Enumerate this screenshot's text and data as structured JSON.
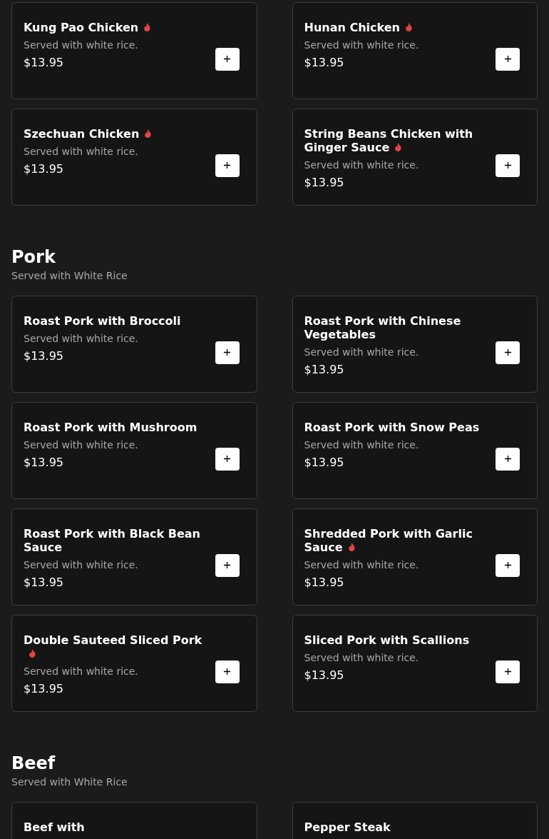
{
  "sections": [
    {
      "items": [
        {
          "name": "Kung Pao Chicken",
          "spicy": true,
          "description": "Served with white rice.",
          "price": "$13.95"
        },
        {
          "name": "Hunan Chicken",
          "spicy": true,
          "description": "Served with white rice.",
          "price": "$13.95"
        },
        {
          "name": "Szechuan Chicken",
          "spicy": true,
          "description": "Served with white rice.",
          "price": "$13.95"
        },
        {
          "name": "String Beans Chicken with Ginger Sauce",
          "spicy": true,
          "description": "Served with white rice.",
          "price": "$13.95"
        }
      ]
    },
    {
      "title": "Pork",
      "subtitle": "Served with White Rice",
      "items": [
        {
          "name": "Roast Pork with Broccoli",
          "spicy": false,
          "description": "Served with white rice.",
          "price": "$13.95"
        },
        {
          "name": "Roast Pork with Chinese Vegetables",
          "spicy": false,
          "description": "Served with white rice.",
          "price": "$13.95"
        },
        {
          "name": "Roast Pork with Mushroom",
          "spicy": false,
          "description": "Served with white rice.",
          "price": "$13.95"
        },
        {
          "name": "Roast Pork with Snow Peas",
          "spicy": false,
          "description": "Served with white rice.",
          "price": "$13.95"
        },
        {
          "name": "Roast Pork with Black Bean Sauce",
          "spicy": false,
          "description": "Served with white rice.",
          "price": "$13.95"
        },
        {
          "name": "Shredded Pork with Garlic Sauce",
          "spicy": true,
          "description": "Served with white rice.",
          "price": "$13.95"
        },
        {
          "name": "Double Sauteed Sliced Pork",
          "spicy": true,
          "description": "Served with white rice.",
          "price": "$13.95"
        },
        {
          "name": "Sliced Pork with Scallions",
          "spicy": false,
          "description": "Served with white rice.",
          "price": "$13.95"
        }
      ]
    },
    {
      "title": "Beef",
      "subtitle": "Served with White Rice",
      "items": [
        {
          "name": "Beef with",
          "spicy": false
        },
        {
          "name": "Pepper Steak",
          "spicy": false
        }
      ]
    }
  ]
}
